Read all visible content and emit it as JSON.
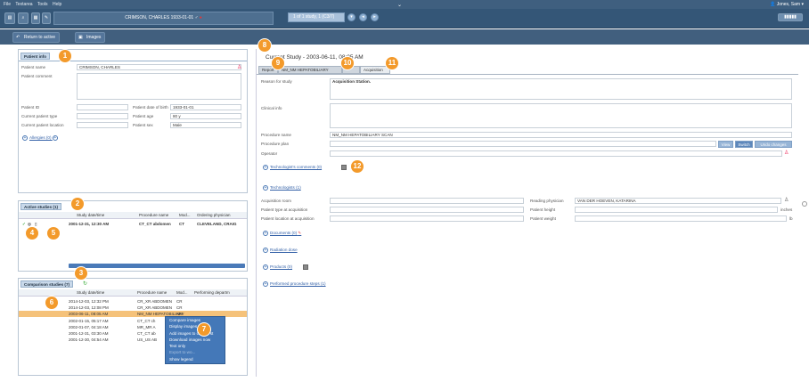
{
  "menubar": {
    "items": [
      "File",
      "Textarea",
      "Tools",
      "Help"
    ],
    "user": "Jones, Sam"
  },
  "toolbar": {
    "patient_title": "CRIMSON, CHARLES 1933-01-01",
    "study_nav": "1 of 1 study, 1 (C3/7)",
    "right_button": "▮▮▮▮▮"
  },
  "subbar": {
    "return_label": "Return to active",
    "images_label": "Images"
  },
  "patient_info": {
    "tab": "Patient info",
    "name_label": "Patient name",
    "name_value": "CRIMSON, CHARLES",
    "comment_label": "Patient comment",
    "id_label": "Patient ID",
    "type_label": "Current patient type",
    "location_label": "Current patient location",
    "dob_label": "Patient date of birth",
    "dob_value": "1933-01-01",
    "age_label": "Patient age",
    "age_value": "80 y",
    "sex_label": "Patient sex",
    "sex_value": "Male",
    "allergies": "Allergies (0)"
  },
  "active_studies": {
    "tab": "Active studies (1)",
    "columns": [
      "Study date/time",
      "Procedure name",
      "Mod...",
      "Ordering physician"
    ],
    "rows": [
      [
        "2001-12-31, 12:30 AM",
        "CT_CT abdomen",
        "CT",
        "CLEVELAND, CRAIG"
      ]
    ]
  },
  "comparison": {
    "tab": "Comparison studies (7)",
    "columns": [
      "Study date/time",
      "Procedure name",
      "Mod...",
      "Performing departm"
    ],
    "rows": [
      [
        "2014-12-03, 12:32 PM",
        "CR_XR ABDOMEN",
        "CR"
      ],
      [
        "2014-12-03, 12:08 PM",
        "CR_XR ABDOMEN",
        "CR"
      ],
      [
        "2003-06-11, 08:05 AM",
        "NM_NM HEPATOBILIARY",
        "NM"
      ],
      [
        "2002-01-15, 05:17 AM",
        "CT_CT ch",
        "CT"
      ],
      [
        "2002-01-07, 04:18 AM",
        "MR_MR A",
        "MR"
      ],
      [
        "2001-12-31, 03:30 AM",
        "CT_CT ab",
        "CT"
      ],
      [
        "2001-12-30, 04:54 AM",
        "US_US AB",
        "US"
      ]
    ],
    "context_menu": [
      "Compare images",
      "Display images",
      "Add images to clinical st",
      "Download images now",
      "Text only",
      "Export to wo...",
      "Show legend"
    ]
  },
  "study": {
    "title": "Current Study - 2003-06-11, 08:05 AM",
    "tabs": [
      "Report",
      "NM_NM HEPATOBILIARY",
      "Acquisition"
    ],
    "reason_label": "Reason for study",
    "reason_value": "Acquisition Station.",
    "clinical_label": "Clinical info",
    "procname_label": "Procedure name",
    "procname_value": "NM_NM HEPATOBILIARY SCAN",
    "procplan_label": "Procedure plan",
    "view": "View",
    "switch": "Switch",
    "undo": "Undo changes",
    "operator_label": "Operator",
    "tech_comments": "Technologist's comments (0)",
    "technologists": "Technologists (1)",
    "acq_room": "Acquisition room",
    "ptype_acq": "Patient type at acquisition",
    "ploc_acq": "Patient location at acquisition",
    "reading_label": "Reading physician",
    "reading_value": "VAN DER HOEVEN, KATARINA",
    "height_label": "Patient height",
    "height_unit": "inches",
    "weight_label": "Patient weight",
    "weight_unit": "lb",
    "documents": "Documents (0)",
    "radiation": "Radiation dose",
    "products": "Products (0)",
    "steps": "Performed procedure steps (1)"
  },
  "badges": [
    "1",
    "2",
    "3",
    "4",
    "5",
    "6",
    "7",
    "8",
    "9",
    "10",
    "11",
    "12"
  ],
  "colors": {
    "badge": "#f39a2b",
    "menubar": "#3f5f7f",
    "selected_row": "#f5c27a",
    "context_menu": "#4478b8"
  }
}
